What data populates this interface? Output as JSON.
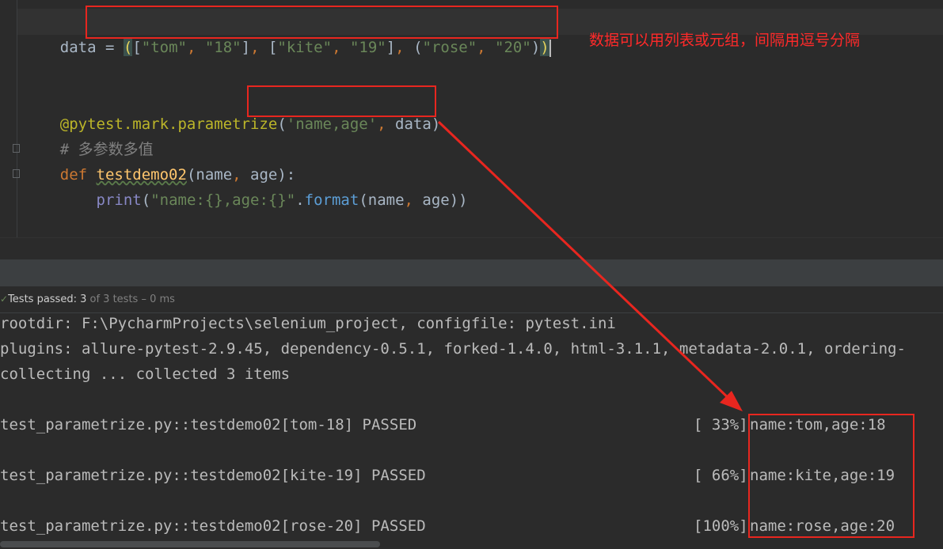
{
  "editor": {
    "line1": {
      "var": "data",
      "assign": " = ",
      "p_open": "(",
      "b1_open": "[",
      "s_tom": "\"tom\"",
      "c1": ", ",
      "s_18": "\"18\"",
      "b1_close": "]",
      "c2": ", ",
      "b2_open": "[",
      "s_kite": "\"kite\"",
      "c3": ", ",
      "s_19": "\"19\"",
      "b2_close": "]",
      "c4": ", ",
      "t_open": "(",
      "s_rose": "\"rose\"",
      "c5": ", ",
      "s_20": "\"20\"",
      "t_close": ")",
      "p_close": ")"
    },
    "line2": {
      "decorator": "@pytest.mark.parametrize",
      "p_open": "(",
      "arg_names": "'name,age'",
      "comma": ", ",
      "arg_data": "data",
      "p_close": ")"
    },
    "line3": {
      "comment": "# 多参数多值"
    },
    "line4": {
      "kw": "def",
      "space": " ",
      "fn": "testdemo02",
      "args_open": "(name",
      "comma": ", ",
      "args_close": "age):"
    },
    "line5": {
      "indent": "    ",
      "builtin": "print",
      "p_open": "(",
      "fmt_str": "\"name:{},age:{}\"",
      "dot": ".",
      "method": "format",
      "args_open": "(name",
      "comma": ", ",
      "args_close": "age))"
    },
    "annotation": "数据可以用列表或元组，间隔用逗号分隔"
  },
  "test_status": {
    "prefix": "Tests passed: ",
    "passed_count": "3",
    "rest": " of 3 tests – 0 ms"
  },
  "console": {
    "lines": [
      "rootdir: F:\\PycharmProjects\\selenium_project, configfile: pytest.ini",
      "plugins: allure-pytest-2.9.45, dependency-0.5.1, forked-1.4.0, html-3.1.1, metadata-2.0.1, ordering-",
      "collecting ... collected 3 items"
    ],
    "results": [
      {
        "test": "test_parametrize.py::testdemo02[tom-18] PASSED",
        "percent": "[ 33%]",
        "output": "name:tom,age:18"
      },
      {
        "test": "test_parametrize.py::testdemo02[kite-19] PASSED",
        "percent": "[ 66%]",
        "output": "name:kite,age:19"
      },
      {
        "test": "test_parametrize.py::testdemo02[rose-20] PASSED",
        "percent": "[100%]",
        "output": "name:rose,age:20"
      }
    ]
  },
  "colors": {
    "annotation_red": "#e8261f",
    "keyword": "#cc7832",
    "string": "#6a8759",
    "decorator": "#bbb529",
    "function": "#ffc66d"
  }
}
